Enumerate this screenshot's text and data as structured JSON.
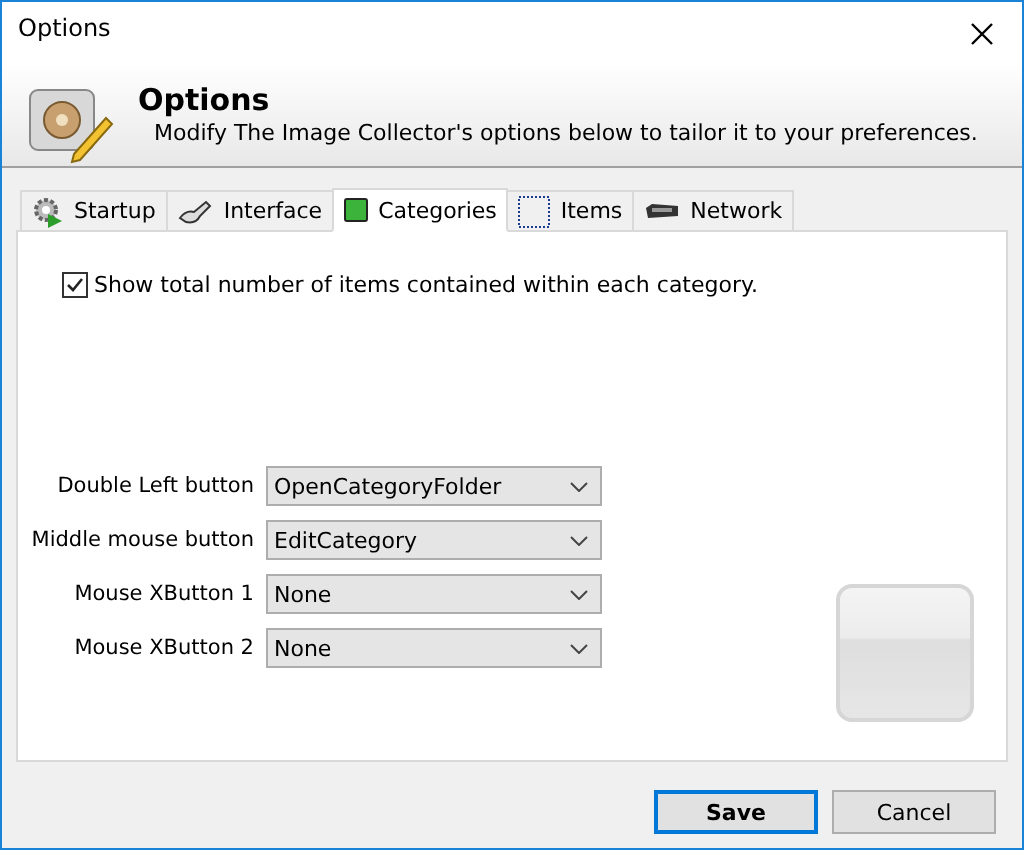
{
  "window": {
    "title": "Options"
  },
  "header": {
    "title": "Options",
    "description": "Modify The Image Collector's options below to tailor it to your preferences."
  },
  "tabs": [
    {
      "label": "Startup",
      "selected": false
    },
    {
      "label": "Interface",
      "selected": false
    },
    {
      "label": "Categories",
      "selected": true
    },
    {
      "label": "Items",
      "selected": false
    },
    {
      "label": "Network",
      "selected": false
    }
  ],
  "show_count": {
    "label": "Show total number of items contained within each category.",
    "checked": true
  },
  "mappings": [
    {
      "label": "Double Left button",
      "value": "OpenCategoryFolder"
    },
    {
      "label": "Middle mouse button",
      "value": "EditCategory"
    },
    {
      "label": "Mouse XButton 1",
      "value": "None"
    },
    {
      "label": "Mouse XButton 2",
      "value": "None"
    }
  ],
  "buttons": [
    {
      "label": "Save",
      "default": true
    },
    {
      "label": "Cancel",
      "default": false
    }
  ]
}
